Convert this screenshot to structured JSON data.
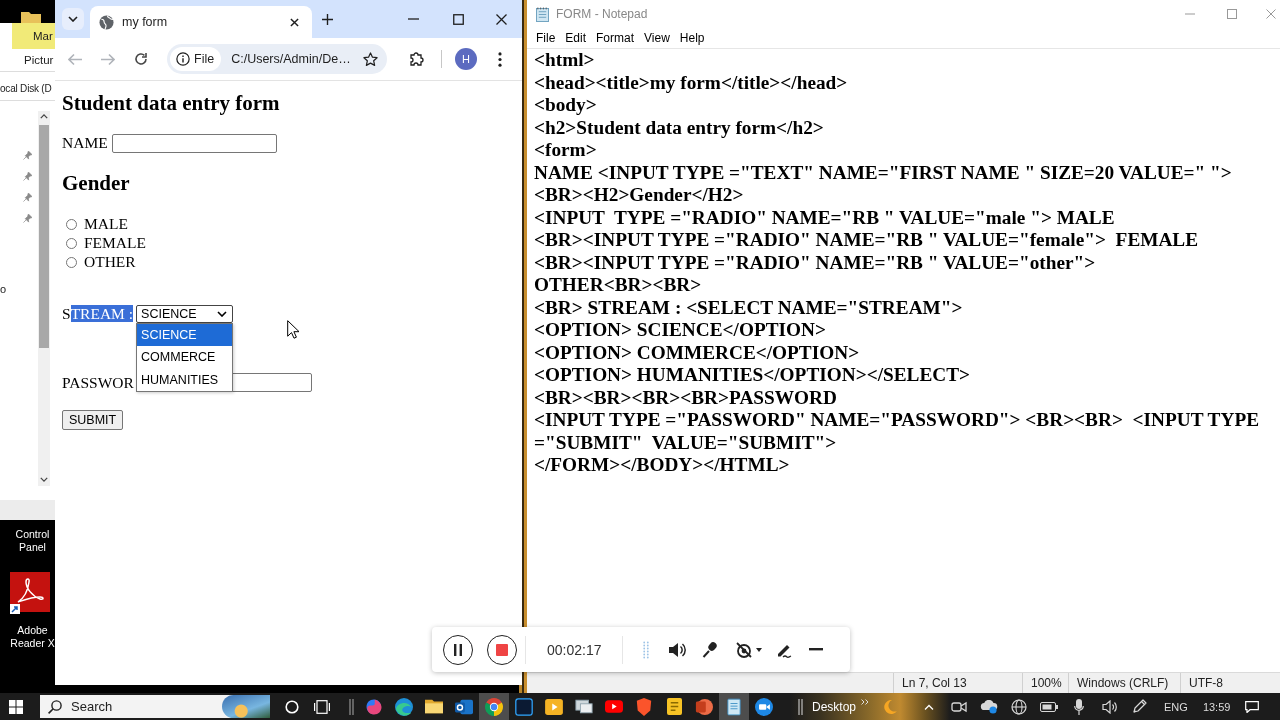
{
  "desktop": {
    "explorer": {
      "ribbon_tab": "Mar",
      "ribbon_item": "Pictur",
      "location": "ocal Disk (D",
      "nav_item": "o"
    },
    "icons": [
      {
        "label": "Control Panel",
        "kind": "text-only"
      },
      {
        "label": "Adobe Reader X",
        "kind": "pdf"
      }
    ]
  },
  "browser": {
    "tabs": [
      {
        "title": "my form",
        "selected": true
      }
    ],
    "back": {
      "disabled": true
    },
    "forward": {
      "disabled": true
    },
    "address": {
      "chip": "File",
      "url": "C:/Users/Admin/De…"
    },
    "profile": "H",
    "page": {
      "heading": "Student data entry form",
      "name_field": {
        "label": "NAME"
      },
      "gender_heading": "Gender",
      "radios": [
        {
          "label": "MALE",
          "checked": false
        },
        {
          "label": "FEMALE",
          "checked": false
        },
        {
          "label": "OTHER",
          "checked": false
        }
      ],
      "stream": {
        "label_parts": [
          {
            "text": "S",
            "highlighted": false
          },
          {
            "text": "TREAM :",
            "highlighted": true
          }
        ],
        "value": "SCIENCE",
        "expanded": true,
        "options": [
          {
            "label": "SCIENCE",
            "selected": true
          },
          {
            "label": "COMMERCE",
            "selected": false
          },
          {
            "label": "HUMANITIES",
            "selected": false
          }
        ]
      },
      "password": {
        "label": "PASSWOR"
      },
      "submit": "SUBMIT"
    }
  },
  "notepad": {
    "title": "FORM - Notepad",
    "menu": [
      "File",
      "Edit",
      "Format",
      "View",
      "Help"
    ],
    "lines": [
      "<html>",
      "<head><title>my form</title></head>",
      "<body>",
      "<h2>Student data entry form</h2>",
      "<form>",
      "NAME <INPUT TYPE =\"TEXT\" NAME=\"FIRST NAME \" SIZE=20 VALUE=\" \">",
      "<BR><H2>Gender</H2>",
      "<INPUT  TYPE =\"RADIO\" NAME=\"RB \" VALUE=\"male \"> MALE",
      "<BR><INPUT TYPE =\"RADIO\" NAME=\"RB \" VALUE=\"female\">  FEMALE",
      "<BR><INPUT TYPE =\"RADIO\" NAME=\"RB \" VALUE=\"other\">",
      "OTHER<BR><BR>",
      "<BR> STREAM : <SELECT NAME=\"STREAM\">",
      "<OPTION> SCIENCE</OPTION>",
      "<OPTION> COMMERCE</OPTION>",
      "<OPTION> HUMANITIES</OPTION></SELECT>",
      "<BR><BR><BR><BR>PASSWORD",
      "<INPUT TYPE =\"PASSWORD\" NAME=\"PASSWORD\"> <BR><BR>  <INPUT TYPE",
      "=\"SUBMIT\"  VALUE=\"SUBMIT\">",
      "</FORM></BODY></HTML>"
    ],
    "status": {
      "position": "Ln 7, Col 13",
      "zoom": "100%",
      "line_endings": "Windows (CRLF)",
      "encoding": "UTF-8"
    }
  },
  "recorder": {
    "elapsed": "00:02:17"
  },
  "taskbar": {
    "search": {
      "placeholder": "Search"
    },
    "apps": [
      {
        "kind": "swirl",
        "active": false
      },
      {
        "kind": "wave",
        "active": false
      },
      {
        "kind": "folder",
        "active": false
      },
      {
        "kind": "mail",
        "active": false
      },
      {
        "kind": "browser",
        "active": true
      },
      {
        "kind": "tile",
        "active": false
      },
      {
        "kind": "play",
        "active": false
      },
      {
        "kind": "windows",
        "active": false
      },
      {
        "kind": "video",
        "active": false
      },
      {
        "kind": "shield",
        "active": false
      },
      {
        "kind": "note",
        "active": false
      },
      {
        "kind": "slides",
        "active": false
      },
      {
        "kind": "notepad",
        "active": true
      },
      {
        "kind": "camera",
        "active": false
      }
    ],
    "toolbar": "Desktop",
    "language": "ENG",
    "time": "13:59"
  }
}
